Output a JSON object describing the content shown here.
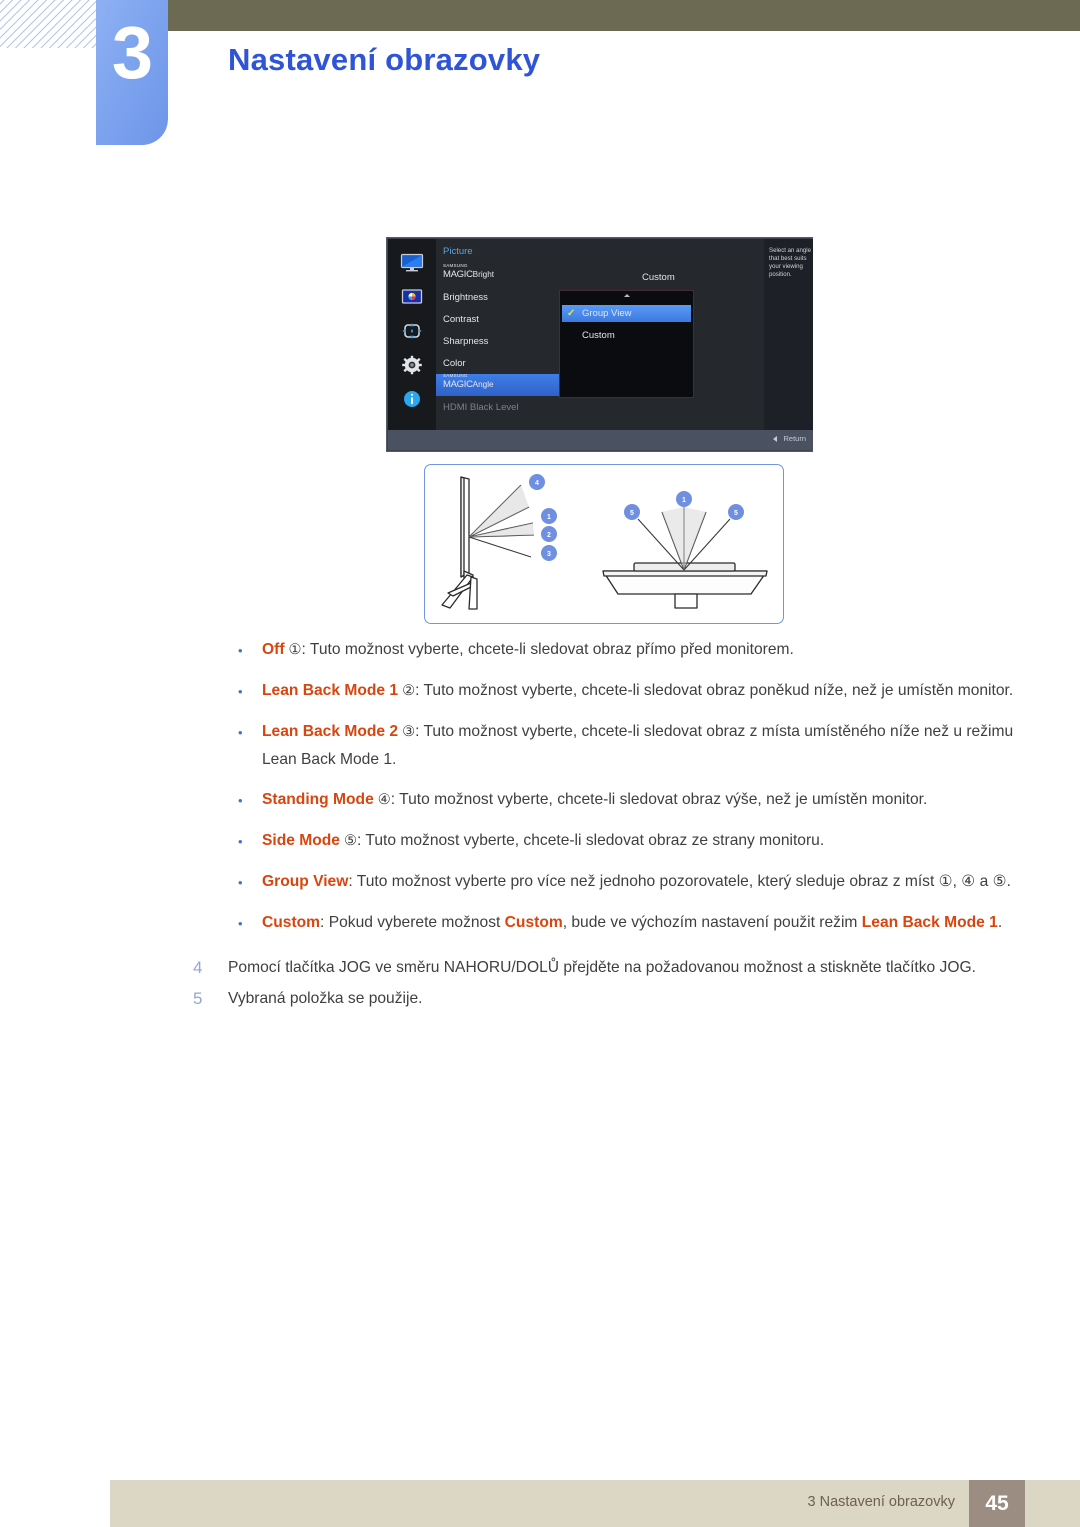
{
  "header": {
    "chapter_number": "3",
    "chapter_title": "Nastavení obrazovky"
  },
  "osd": {
    "menu_title": "Picture",
    "description": "Select an angle that best suits your viewing position.",
    "return_label": "Return",
    "sidebar_icons": [
      "monitor-icon",
      "picture-icon",
      "move-arrows-icon",
      "gear-icon",
      "info-icon"
    ],
    "items": [
      {
        "samsung": "SAMSUNG",
        "magic": "MAGIC",
        "suffix": "Bright",
        "plain": "",
        "value": "Custom",
        "selected": false,
        "dim": false
      },
      {
        "samsung": "",
        "magic": "",
        "suffix": "",
        "plain": "Brightness",
        "value": "",
        "selected": false,
        "dim": false
      },
      {
        "samsung": "",
        "magic": "",
        "suffix": "",
        "plain": "Contrast",
        "value": "",
        "selected": false,
        "dim": false
      },
      {
        "samsung": "",
        "magic": "",
        "suffix": "",
        "plain": "Sharpness",
        "value": "",
        "selected": false,
        "dim": false
      },
      {
        "samsung": "",
        "magic": "",
        "suffix": "",
        "plain": "Color",
        "value": "",
        "selected": false,
        "dim": false
      },
      {
        "samsung": "SAMSUNG",
        "magic": "MAGIC",
        "suffix": "Angle",
        "plain": "",
        "value": "",
        "selected": true,
        "dim": false
      },
      {
        "samsung": "",
        "magic": "",
        "suffix": "",
        "plain": "HDMI Black Level",
        "value": "",
        "selected": false,
        "dim": true
      }
    ],
    "popup": {
      "options": [
        {
          "label": "Group View",
          "checked": true
        },
        {
          "label": "Custom",
          "checked": false
        }
      ]
    },
    "colors": {
      "highlight": "#3f7ee8",
      "title": "#53a6e8",
      "check": "#e8e82a"
    }
  },
  "diagram": {
    "side_view_labels": [
      "4",
      "1",
      "2",
      "3"
    ],
    "top_view_labels": [
      "5",
      "1",
      "5"
    ],
    "badge_color": "#6f8fe0",
    "border_color": "#6f96e8"
  },
  "bullets": [
    {
      "keyword": "Off",
      "circle": " ①",
      "rest": ": Tuto možnost vyberte, chcete-li sledovat obraz přímo před monitorem."
    },
    {
      "keyword": "Lean Back Mode 1",
      "circle": " ②",
      "rest": ": Tuto možnost vyberte, chcete-li sledovat obraz poněkud níže, než je umístěn monitor."
    },
    {
      "keyword": "Lean Back Mode 2",
      "circle": " ③",
      "rest": ": Tuto možnost vyberte, chcete-li sledovat obraz z místa umístěného níže než u režimu Lean Back Mode 1."
    },
    {
      "keyword": "Standing Mode",
      "circle": " ④",
      "rest": ": Tuto možnost vyberte, chcete-li sledovat obraz výše, než je umístěn monitor."
    },
    {
      "keyword": "Side Mode",
      "circle": " ⑤",
      "rest": ": Tuto možnost vyberte, chcete-li sledovat obraz ze strany monitoru."
    },
    {
      "keyword": "Group View",
      "circle": "",
      "rest": ": Tuto možnost vyberte pro více než jednoho pozorovatele, který sleduje obraz z míst ①, ④ a ⑤."
    }
  ],
  "custom_bullet": {
    "keyword": "Custom",
    "part1": ": Pokud vyberete možnost ",
    "keyword2": "Custom",
    "part2": ", bude ve výchozím nastavení použit režim ",
    "keyword3": "Lean Back Mode 1",
    "part3": "."
  },
  "steps": [
    {
      "number": "4",
      "text": "Pomocí tlačítka JOG ve směru NAHORU/DOLŮ přejděte na požadovanou možnost a stiskněte tlačítko JOG."
    },
    {
      "number": "5",
      "text": "Vybraná položka se použije."
    }
  ],
  "footer": {
    "text": "3 Nastavení obrazovky",
    "page": "45"
  }
}
